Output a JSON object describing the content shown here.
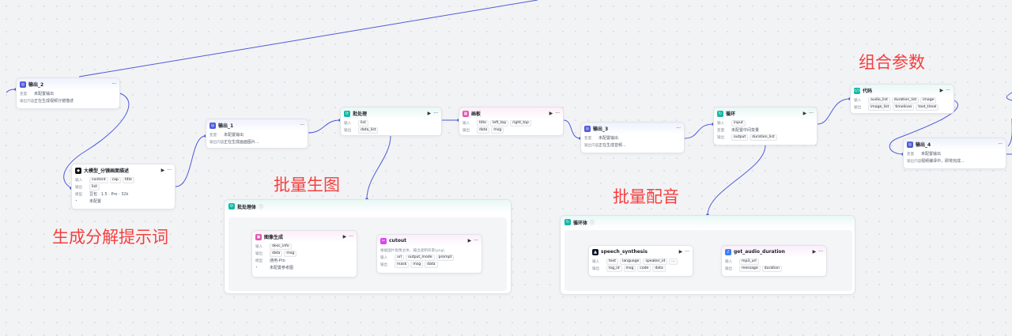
{
  "annotations": {
    "decompose": "生成分解提示词",
    "batch_image": "批量生图",
    "batch_audio": "批量配音",
    "combine": "组合参数"
  },
  "common": {
    "run": "▶",
    "more": "···",
    "input": "输入",
    "output": "输出",
    "content": "输出内容",
    "var": "变量",
    "model": "模型",
    "unset": "未配置输出"
  },
  "nodes": {
    "out2": {
      "title": "输出_2",
      "r1": "未配置输出",
      "r2": "正在生成视频分镜描述"
    },
    "llm": {
      "title": "大模型_分镜画面描述",
      "in": [
        "content",
        "cap",
        "title"
      ],
      "out": [
        "list"
      ],
      "model": "豆包 · 1.5 · Pro · 32k",
      "unset": "未配置"
    },
    "out1": {
      "title": "输出_1",
      "r1": "未配置输出",
      "r2": "正在生成画面图片..."
    },
    "batch": {
      "title": "批处理",
      "in": [
        "list"
      ],
      "out": [
        "data_list"
      ]
    },
    "canvas": {
      "title": "画板",
      "in": [
        "title",
        "left_top",
        "right_top"
      ],
      "out": [
        "data",
        "msg"
      ]
    },
    "out3": {
      "title": "输出_3",
      "r1": "未配置输出",
      "r2": "正在生成音频..."
    },
    "loop": {
      "title": "循环",
      "in": [
        "input"
      ],
      "mid": "未配置中间变量",
      "out": [
        "output",
        "duration_list"
      ]
    },
    "code": {
      "title": "代码",
      "in": [
        "audio_list",
        "duration_list",
        "image"
      ],
      "out": [
        "image_list",
        "timelines",
        "text_timel"
      ]
    },
    "out4": {
      "title": "输出_4",
      "r1": "未配置输出",
      "r2": "视频编译中，即将完成..."
    },
    "batchBody": {
      "title": "批处理体"
    },
    "imgGen": {
      "title": "图像生成",
      "in": [
        "desc_info"
      ],
      "out": [
        "data",
        "msg"
      ],
      "model": "通用-Pro",
      "ref": "未配置参考图"
    },
    "cutout": {
      "title": "cutout",
      "desc": "根据图片抠像主体，输出透明背景(png)",
      "in": [
        "url",
        "output_mode",
        "prompt"
      ],
      "out": [
        "mask",
        "msg",
        "data"
      ]
    },
    "loopBody": {
      "title": "循环体"
    },
    "speech": {
      "title": "speech_synthesis",
      "in": [
        "text",
        "language",
        "speaker_id",
        "..."
      ],
      "out": [
        "log_id",
        "msg",
        "code",
        "data"
      ]
    },
    "audioDur": {
      "title": "get_audio_duration",
      "in": [
        "mp3_url"
      ],
      "out": [
        "message",
        "duration"
      ]
    }
  },
  "colors": {
    "edge": "#4e5bd8",
    "annotation": "#f53f3f",
    "output_icon": "#4e5bd8",
    "llm_icon": "#111111",
    "batch_icon": "#14b8a6",
    "canvas_icon": "#e056b0",
    "cutout_icon": "#d946ef",
    "code_icon": "#14b8a6"
  }
}
